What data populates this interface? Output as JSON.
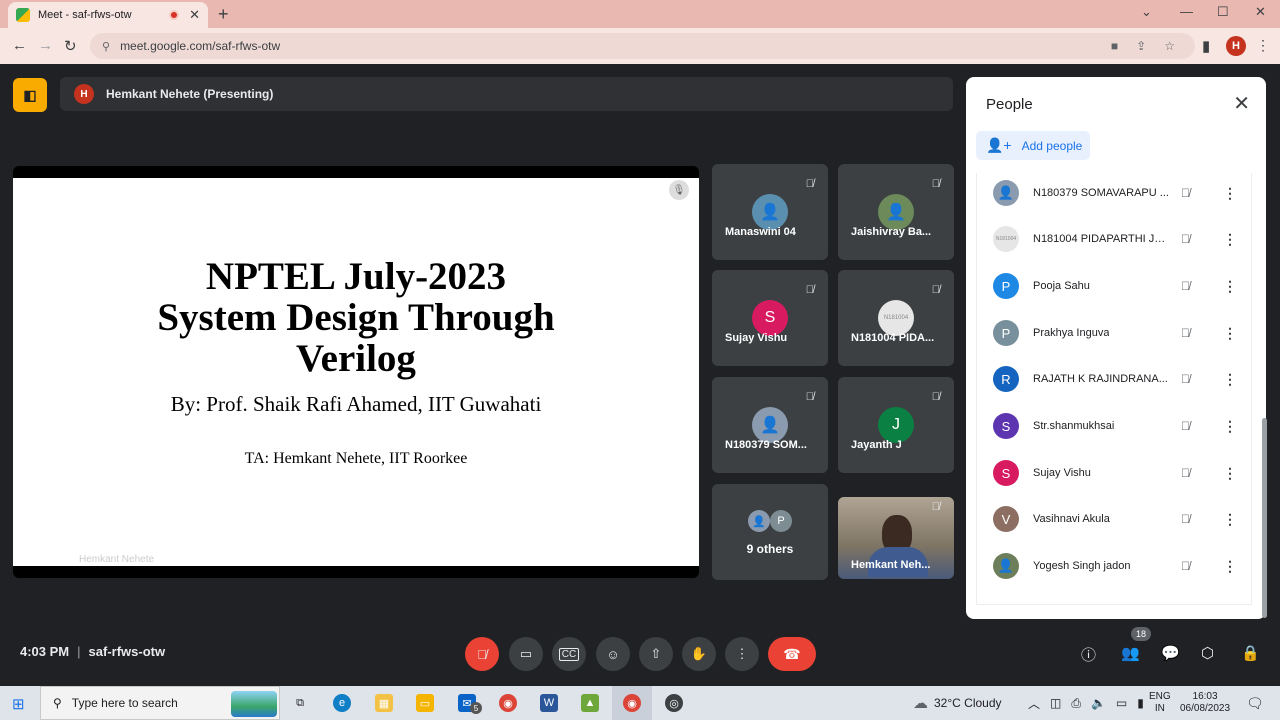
{
  "browser": {
    "tab_title": "Meet - saf-rfws-otw",
    "url": "meet.google.com/saf-rfws-otw",
    "profile_initial": "H"
  },
  "meet": {
    "presenting_label": "Hemkant Nehete (Presenting)",
    "presenter_initial": "H",
    "slide": {
      "title_line1": "NPTEL July-2023",
      "title_line2": "System Design Through",
      "title_line3": "Verilog",
      "by": "By: Prof. Shaik Rafi Ahamed, IIT Guwahati",
      "ta": "TA: Hemkant Nehete, IIT Roorkee",
      "presenter_caption": "Hemkant Nehete"
    },
    "tiles": [
      {
        "name": "Manaswini 04",
        "initial": "",
        "color": "#5b8fb0"
      },
      {
        "name": "Jaishivray Ba...",
        "initial": "",
        "color": "#6d8a5a"
      },
      {
        "name": "Sujay Vishu",
        "initial": "S",
        "color": "#d81b60"
      },
      {
        "name": "N181004 PIDA...",
        "initial": "",
        "color": "#e6e6e6"
      },
      {
        "name": "N180379 SOM...",
        "initial": "",
        "color": "#8a9bb0"
      },
      {
        "name": "Jayanth J",
        "initial": "J",
        "color": "#0b8043"
      },
      {
        "name": "9 others",
        "initial": "P",
        "color": "#7e8c94"
      },
      {
        "name": "Hemkant Neh...",
        "initial": "",
        "color": ""
      }
    ],
    "meeting_time": "4:03 PM",
    "meeting_code": "saf-rfws-otw",
    "participant_count": "18"
  },
  "people_panel": {
    "title": "People",
    "add_people_label": "Add people",
    "people": [
      {
        "name": "N180379 SOMAVARAPU ...",
        "initial": "",
        "color": "#8a9bb0"
      },
      {
        "name": "N181004 PIDAPARTHI JA...",
        "initial": "",
        "color": "#e6e6e6"
      },
      {
        "name": "Pooja Sahu",
        "initial": "P",
        "color": "#1e88e5"
      },
      {
        "name": "Prakhya Inguva",
        "initial": "P",
        "color": "#78909c"
      },
      {
        "name": "RAJATH K RAJINDRANA...",
        "initial": "R",
        "color": "#1565c0"
      },
      {
        "name": "Str.shanmukhsai",
        "initial": "S",
        "color": "#5e35b1"
      },
      {
        "name": "Sujay Vishu",
        "initial": "S",
        "color": "#d81b60"
      },
      {
        "name": "Vasihnavi Akula",
        "initial": "V",
        "color": "#8d6e63"
      },
      {
        "name": "Yogesh Singh jadon",
        "initial": "",
        "color": "#6d7f5a"
      }
    ]
  },
  "taskbar": {
    "search_placeholder": "Type here to search",
    "weather": "32°C  Cloudy",
    "lang_line1": "ENG",
    "lang_line2": "IN",
    "clock_time": "16:03",
    "clock_date": "06/08/2023",
    "mail_badge": "5"
  }
}
